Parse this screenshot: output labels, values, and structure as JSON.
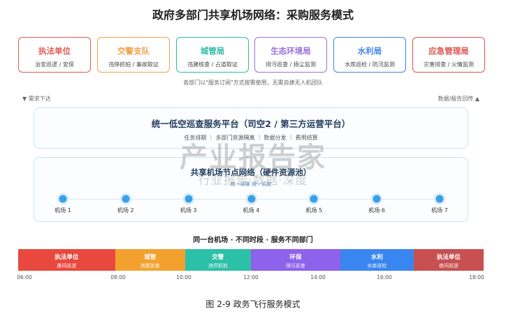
{
  "title": "政府多部门共享机场网络：采购服务模式",
  "departments": [
    {
      "name": "执法单位",
      "desc": "治安巡逻 / 安保",
      "color": "#e05a4e"
    },
    {
      "name": "交警支队",
      "desc": "违停抓拍 / 事故取证",
      "color": "#f0a24a"
    },
    {
      "name": "城管局",
      "desc": "违建核查 / 占道取证",
      "color": "#2bbba4"
    },
    {
      "name": "生态环境局",
      "desc": "排污巡查 / 扬尘监测",
      "color": "#9b6fe0"
    },
    {
      "name": "水利局",
      "desc": "水库巡检 / 防汛监测",
      "color": "#3d85e6"
    },
    {
      "name": "应急管理局",
      "desc": "灾害排查 / 火情监测",
      "color": "#d9534f"
    }
  ],
  "note": "各部门以\"服务订阅\"方式按需使用，无需自建无人机团队",
  "left_label": "▼ 需求下达",
  "right_label": "数据/报告回传 ▲",
  "platform": {
    "title": "统一低空巡查服务平台（司空2 / 第三方运营平台）",
    "functions": "任务排期 ｜ 多部门资源隔离 ｜ 数据分发 ｜ 费用结算"
  },
  "network": {
    "title": "共享机场节点网络（硬件资源池）",
    "subtitle": "统一部署 统一调度"
  },
  "airports": [
    "机场 1",
    "机场 2",
    "机场 3",
    "机场 4",
    "机场 5",
    "机场 6",
    "机场 7"
  ],
  "schedule_title": "同一台机场 · 不同时段 · 服务不同部门",
  "schedule": [
    {
      "name": "执法单位",
      "desc": "晨间巡逻",
      "color": "#e8483e",
      "start": 6,
      "end": 8.5
    },
    {
      "name": "城管",
      "desc": "违建巡查",
      "color": "#f3a12e",
      "start": 8.5,
      "end": 10.3
    },
    {
      "name": "交警",
      "desc": "违停抓拍",
      "color": "#2cc0a8",
      "start": 10.3,
      "end": 12
    },
    {
      "name": "环保",
      "desc": "排污巡查",
      "color": "#8e62ea",
      "start": 12,
      "end": 14.3
    },
    {
      "name": "水利",
      "desc": "水库巡检",
      "color": "#3a86f0",
      "start": 14.3,
      "end": 16.2
    },
    {
      "name": "执法单位",
      "desc": "夜间巡逻",
      "color": "#c85050",
      "start": 16.2,
      "end": 18
    }
  ],
  "schedule_range": [
    6,
    18
  ],
  "time_ticks": [
    "06:00",
    "08:00",
    "10:00",
    "12:00",
    "14:00",
    "16:00",
    "18:00"
  ],
  "caption": "图 2-9  政务飞行服务模式",
  "watermark": {
    "main": "产业报告家",
    "sub": "行业报告·数据·深度"
  }
}
